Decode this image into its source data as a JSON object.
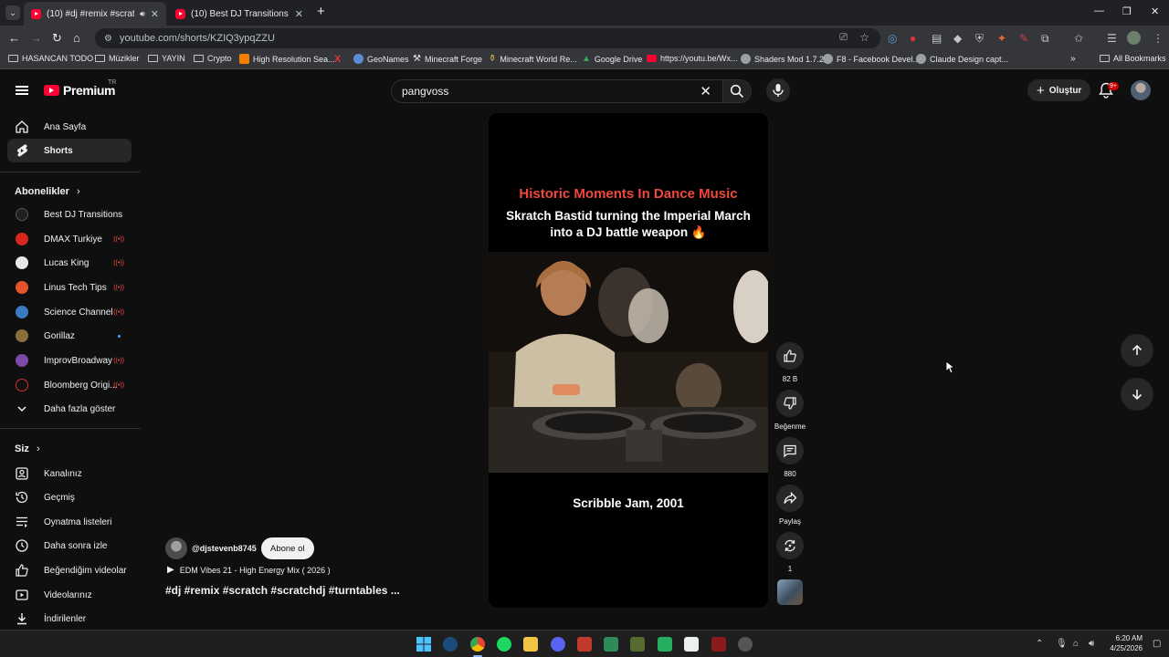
{
  "browser": {
    "tabs": [
      {
        "title": "(10) #dj #remix #scratch #s",
        "active": true
      },
      {
        "title": "(10) Best DJ Transitions - YouTu",
        "active": false
      }
    ],
    "new_tab_label": "+",
    "url": "youtube.com/shorts/KZIQ3ypqZZU",
    "bookmarks": [
      {
        "label": "HASANCAN TODO",
        "icon": "folder-icon"
      },
      {
        "label": "Müzikler",
        "icon": "folder-icon"
      },
      {
        "label": "YAYIN",
        "icon": "folder-icon"
      },
      {
        "label": "Crypto",
        "icon": "folder-icon"
      },
      {
        "label": "High Resolution Sea...",
        "icon": "blogger-icon"
      },
      {
        "label": "GeoNames",
        "icon": "x-icon"
      },
      {
        "label": "Minecraft Forge",
        "icon": "anvil-icon"
      },
      {
        "label": "Minecraft World Re...",
        "icon": "bottle-icon"
      },
      {
        "label": "Google Drive",
        "icon": "drive-icon"
      },
      {
        "label": "https://youtu.be/Wx...",
        "icon": "youtube-icon"
      },
      {
        "label": "Shaders Mod 1.7.2",
        "icon": "globe-icon"
      },
      {
        "label": "F8 - Facebook Devel...",
        "icon": "globe-icon"
      },
      {
        "label": "Claude Design capt...",
        "icon": "globe-icon"
      }
    ],
    "all_bookmarks_label": "All Bookmarks"
  },
  "youtube": {
    "logo_text": "Premium",
    "logo_region": "TR",
    "search_value": "pangvoss",
    "create_label": "Oluştur",
    "notification_count": "9+"
  },
  "sidebar": {
    "main": [
      {
        "label": "Ana Sayfa",
        "icon": "home-icon",
        "selected": false
      },
      {
        "label": "Shorts",
        "icon": "shorts-icon",
        "selected": true
      }
    ],
    "subscriptions_title": "Abonelikler",
    "subscriptions": [
      {
        "label": "Best DJ Transitions",
        "color": "#1f1f1f",
        "live": false,
        "new": false
      },
      {
        "label": "DMAX Turkiye",
        "color": "#d7261e",
        "live": true,
        "new": false
      },
      {
        "label": "Lucas King",
        "color": "#e8e8e8",
        "live": true,
        "new": false
      },
      {
        "label": "Linus Tech Tips",
        "color": "#e2522b",
        "live": true,
        "new": false
      },
      {
        "label": "Science Channel",
        "color": "#3a7cc0",
        "live": true,
        "new": false
      },
      {
        "label": "Gorillaz",
        "color": "#8a6d3b",
        "live": false,
        "new": true
      },
      {
        "label": "ImprovBroadway",
        "color": "#7b4aa8",
        "live": true,
        "new": false
      },
      {
        "label": "Bloomberg Origi...",
        "color": "#111111",
        "live": true,
        "new": false
      }
    ],
    "show_more_label": "Daha fazla göster",
    "you_title": "Siz",
    "you_items": [
      {
        "label": "Kanalınız",
        "icon": "channel-icon"
      },
      {
        "label": "Geçmiş",
        "icon": "history-icon"
      },
      {
        "label": "Oynatma listeleri",
        "icon": "playlists-icon"
      },
      {
        "label": "Daha sonra izle",
        "icon": "watch-later-icon"
      },
      {
        "label": "Beğendiğim videolar",
        "icon": "liked-icon"
      },
      {
        "label": "Videolarınız",
        "icon": "your-videos-icon"
      },
      {
        "label": "İndirilenler",
        "icon": "downloads-icon"
      }
    ]
  },
  "short": {
    "overlay_title": "Historic Moments In Dance Music",
    "overlay_subtitle": "Skratch Bastid turning the Imperial March into a DJ battle weapon 🔥",
    "overlay_bottom": "Scribble Jam, 2001",
    "channel_handle": "@djstevenb8745",
    "subscribe_label": "Abone ol",
    "music_label": "EDM Vibes 21 - High Energy Mix ( 2026 )",
    "caption": "#dj #remix #scratch #scratchdj #turntables ..."
  },
  "actions": {
    "like_count": "82 B",
    "dislike_label": "Beğenme",
    "comment_count": "880",
    "share_label": "Paylaş",
    "remix_count": "1"
  },
  "taskbar": {
    "time": "6:20 AM",
    "date": "4/25/2026"
  }
}
